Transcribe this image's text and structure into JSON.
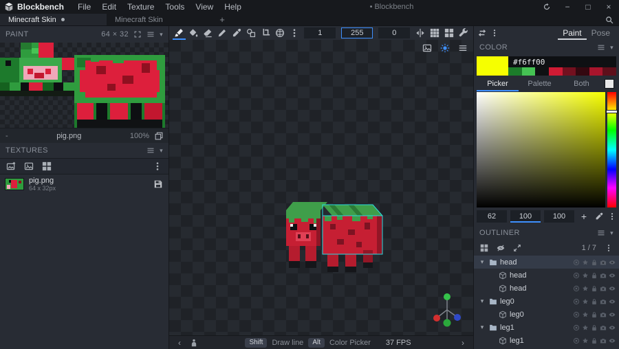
{
  "colors": {
    "accent": "#3e90ff",
    "current_color": "#f6ff00",
    "hue_pure": "#f7ff00",
    "selection_outline": "#2bd9e0"
  },
  "glyphs": {
    "minimize": "−",
    "maximize": "□",
    "close": "×",
    "collapse": "▾",
    "chevron_left": "‹",
    "chevron_right": "›",
    "plus": "+"
  },
  "titlebar": {
    "app_name": "Blockbench",
    "menus": [
      "File",
      "Edit",
      "Texture",
      "Tools",
      "View",
      "Help"
    ],
    "window_title": "• Blockbench"
  },
  "tabbar": {
    "tabs": [
      {
        "label": "Minecraft Skin",
        "active": true,
        "unsaved": true
      },
      {
        "label": "Minecraft Skin",
        "active": false,
        "unsaved": false
      }
    ]
  },
  "left_panel": {
    "paint": {
      "title": "PAINT",
      "texture_size": "64 × 32",
      "footer": {
        "mode": "-",
        "file_name": "pig.png",
        "zoom": "100%"
      }
    },
    "textures": {
      "title": "TEXTURES",
      "items": [
        {
          "name": "pig.png",
          "size": "64 x 32px"
        }
      ]
    }
  },
  "toolbar": {
    "brush_size": "1",
    "opacity": "255",
    "softness": "0"
  },
  "canvas": {
    "statusbar": {
      "hints": [
        {
          "key": "Shift",
          "action": "Draw line"
        },
        {
          "key": "Alt",
          "action": "Color Picker"
        }
      ],
      "fps": "37 FPS"
    }
  },
  "right_panel": {
    "mode_tabs": [
      {
        "label": "Paint",
        "active": true
      },
      {
        "label": "Pose",
        "active": false
      }
    ],
    "color": {
      "title": "COLOR",
      "hex": "#f6ff00",
      "palette": [
        "#1c7c2a",
        "#45c253",
        "#0f1113",
        "#d01b34",
        "#73101f",
        "#340810",
        "#a8152c",
        "#5e0f1b"
      ],
      "tabs": [
        {
          "label": "Picker",
          "active": true
        },
        {
          "label": "Palette",
          "active": false
        },
        {
          "label": "Both",
          "active": false
        }
      ],
      "secondary_swatch": "#e8e8e8",
      "h": "62",
      "s": "100",
      "v": "100"
    },
    "outliner": {
      "title": "OUTLINER",
      "count": "1 / 7",
      "tree": [
        {
          "label": "head",
          "type": "group",
          "depth": 0,
          "selected": true
        },
        {
          "label": "head",
          "type": "cube",
          "depth": 1,
          "selected": false
        },
        {
          "label": "head",
          "type": "cube",
          "depth": 1,
          "selected": false
        },
        {
          "label": "leg0",
          "type": "group",
          "depth": 0,
          "selected": false
        },
        {
          "label": "leg0",
          "type": "cube",
          "depth": 1,
          "selected": false
        },
        {
          "label": "leg1",
          "type": "group",
          "depth": 0,
          "selected": false
        },
        {
          "label": "leg1",
          "type": "cube",
          "depth": 1,
          "selected": false
        }
      ]
    }
  }
}
